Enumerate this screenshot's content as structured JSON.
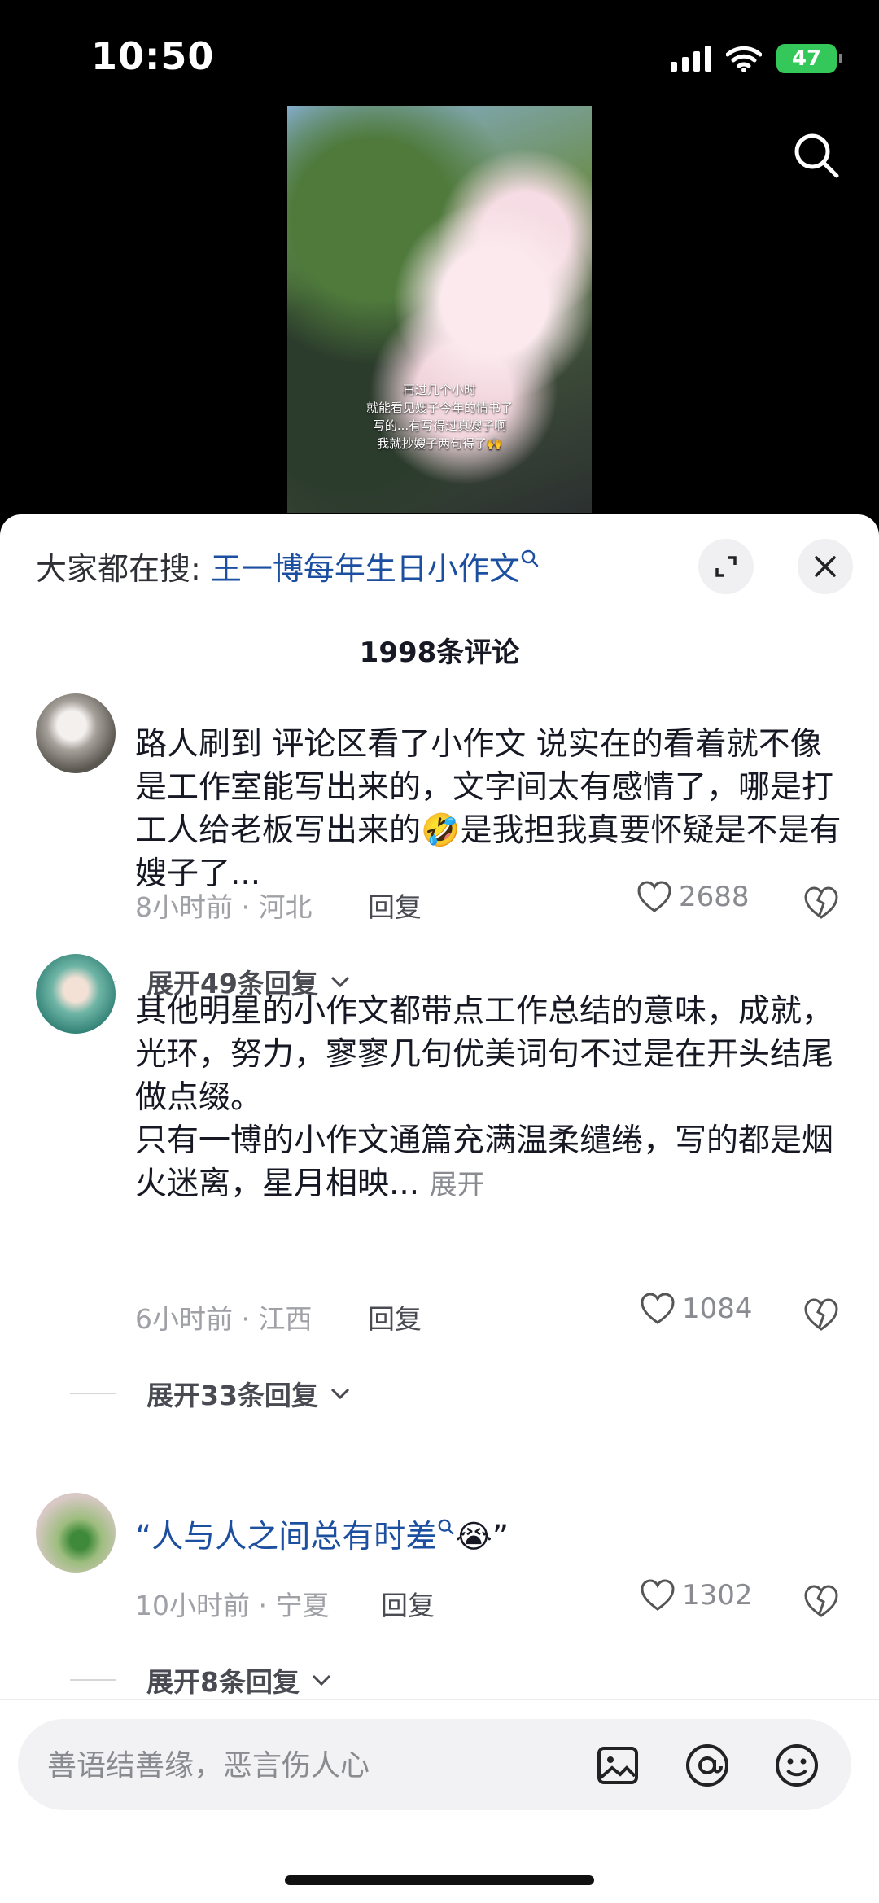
{
  "status_bar": {
    "time": "10:50",
    "battery": "47"
  },
  "video": {
    "caption": "再过几个小时\n就能看见嫂子今年的情书了\n写的...有写得过真嫂子啊\n我就抄嫂子两句得了🙌"
  },
  "sheet": {
    "trending_prefix": "大家都在搜: ",
    "trending_query": "王一博每年生日小作文",
    "comment_count": "1998条评论"
  },
  "comments": [
    {
      "text": "路人刷到 评论区看了小作文 说实在的看着就不像是工作室能写出来的，文字间太有感情了，哪是打工人给老板写出来的🤣是我担我真要怀疑是不是有嫂子了...",
      "meta": "8小时前 · 河北",
      "reply": "回复",
      "likes": "2688",
      "expand": "展开49条回复"
    },
    {
      "text": "其他明星的小作文都带点工作总结的意味，成就，光环，努力，寥寥几句优美词句不过是在开头结尾做点缀。\n只有一博的小作文通篇充满温柔缱绻，写的都是烟火迷离，星月相映...",
      "more": "展开",
      "meta": "6小时前 · 江西",
      "reply": "回复",
      "likes": "1084",
      "expand": "展开33条回复"
    },
    {
      "quote_open": "“",
      "text": "人与人之间总有时差",
      "emoji": "😭",
      "quote_close": "”",
      "meta": "10小时前 · 宁夏",
      "reply": "回复",
      "likes": "1302",
      "expand": "展开8条回复"
    }
  ],
  "input": {
    "placeholder": "善语结善缘，恶言伤人心"
  },
  "icons": [
    "search-icon",
    "expand-icon",
    "close-icon",
    "heart-icon",
    "dislike-icon",
    "chevron-down-icon",
    "image-icon",
    "at-icon",
    "emoji-icon"
  ]
}
